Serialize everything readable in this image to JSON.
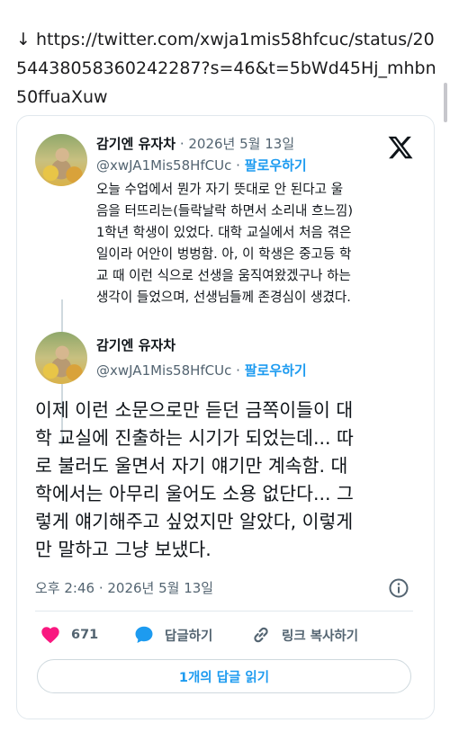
{
  "url": {
    "arrow": "↓",
    "text": "https://twitter.com/xwja1mis58hfcuc/status/2054438058360242287?s=46&t=5bWd45Hj_mhbn50ffuaXuw"
  },
  "reply_tweet": {
    "display_name": "감기엔 유자차",
    "separator": "·",
    "date": "2026년 5월 13일",
    "handle": "@xwJA1Mis58HfCUc",
    "follow_label": "팔로우하기",
    "text": "오늘 수업에서  뭔가 자기 뜻대로 안 된다고 울\n음을 터뜨리는(들락날락 하면서 소리내 흐느낌)\n1학년 학생이 있었다. 대학 교실에서 처음 겪은\n일이라 어안이 벙벙함. 아, 이 학생은 중고등 학\n교 때 이런 식으로 선생을 움직여왔겠구나 하는\n생각이 들었으며, 선생님들께 존경심이 생겼다."
  },
  "main_tweet": {
    "display_name": "감기엔 유자차",
    "handle": "@xwJA1Mis58HfCUc",
    "separator": "·",
    "follow_label": "팔로우하기",
    "text": "이제 이런 소문으로만 듣던 금쪽이들이 대\n학 교실에 진출하는 시기가 되었는데... 따\n로 불러도 울면서 자기  얘기만 계속함. 대\n학에서는 아무리 울어도 소용 없단다... 그\n렇게 얘기해주고 싶었지만 알았다, 이렇게\n만 말하고 그냥 보냈다.",
    "timestamp": "오후 2:46 · 2026년 5월 13일"
  },
  "actions": {
    "like_count": "671",
    "reply_label": "답글하기",
    "copy_link_label": "링크 복사하기",
    "read_replies_label": "1개의 답글 읽기"
  },
  "colors": {
    "accent": "#1d9bf0",
    "like": "#f91880",
    "muted": "#536471",
    "text": "#0f1419"
  },
  "icons": [
    "x-logo-icon",
    "info-icon",
    "heart-icon",
    "speech-bubble-icon",
    "link-icon",
    "down-arrow-icon"
  ]
}
